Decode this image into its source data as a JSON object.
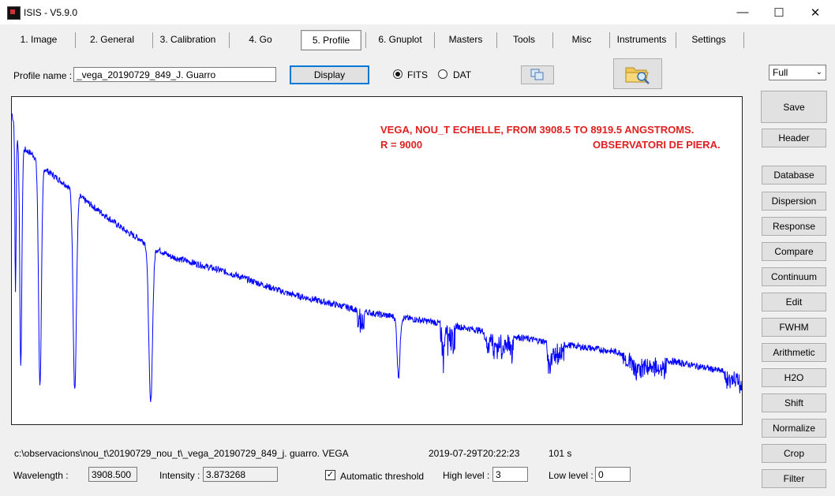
{
  "window": {
    "title": "ISIS - V5.9.0",
    "minimize_glyph": "—",
    "maximize_glyph": "☐",
    "close_glyph": "✕"
  },
  "tabs": [
    {
      "label": "1. Image"
    },
    {
      "label": "2. General"
    },
    {
      "label": "3. Calibration"
    },
    {
      "label": "4. Go"
    },
    {
      "label": "5. Profile"
    },
    {
      "label": "6. Gnuplot"
    },
    {
      "label": "Masters"
    },
    {
      "label": "Tools"
    },
    {
      "label": "Misc"
    },
    {
      "label": "Instruments"
    },
    {
      "label": "Settings"
    }
  ],
  "active_tab": "5. Profile",
  "profile": {
    "name_label": "Profile name :",
    "name_value": "_vega_20190729_849_J. Guarro",
    "display_button": "Display",
    "format_options": [
      {
        "label": "FITS",
        "selected": true
      },
      {
        "label": "DAT",
        "selected": false
      }
    ],
    "copy_icon": "copy-icon",
    "open_icon": "folder-magnifier-icon"
  },
  "plot": {
    "annotation_line1": "VEGA,  NOU_T  ECHELLE,  FROM 3908.5   TO 8919.5 ANGSTROMS.",
    "annotation_r": "R = 9000",
    "annotation_obs": "OBSERVATORI DE PIERA.",
    "line_color": "#0000ff",
    "annotation_color": "#e02020"
  },
  "chart_data": {
    "type": "line",
    "title": "",
    "xlabel": "",
    "ylabel": "",
    "xlim": [
      3908.5,
      8919.5
    ],
    "series": [
      {
        "x": [
          3908.5,
          3933.7,
          3970.1,
          4101.7,
          4340.5,
          4500,
          4861.3,
          5200,
          5890,
          6562.8,
          6870,
          7200,
          7600,
          8000,
          8500,
          8919.5
        ],
        "values": [
          3.87,
          1.2,
          0.55,
          0.35,
          0.3,
          3.1,
          0.28,
          2.8,
          2.3,
          1.1,
          1.5,
          1.45,
          1.2,
          1.15,
          1.05,
          0.95
        ]
      }
    ],
    "grid": false
  },
  "status": {
    "path": "c:\\observacions\\nou_t\\20190729_nou_t\\_vega_20190729_849_j. guarro. VEGA",
    "datetime": "2019-07-29T20:22:23",
    "exposure": "101 s",
    "wavelength_label": "Wavelength :",
    "wavelength_value": "3908.500",
    "intensity_label": "Intensity :",
    "intensity_value": "3.873268",
    "auto_threshold_label": "Automatic threshold",
    "auto_threshold_checked": true,
    "high_label": "High level :",
    "high_value": "3",
    "low_label": "Low level :",
    "low_value": "0"
  },
  "right_panel": {
    "zoom_select": "Full",
    "buttons": [
      "Save",
      "Header",
      "Database",
      "Dispersion",
      "Response",
      "Compare",
      "Continuum",
      "Edit",
      "FWHM",
      "Arithmetic",
      "H2O",
      "Shift",
      "Normalize",
      "Crop",
      "Filter"
    ]
  }
}
